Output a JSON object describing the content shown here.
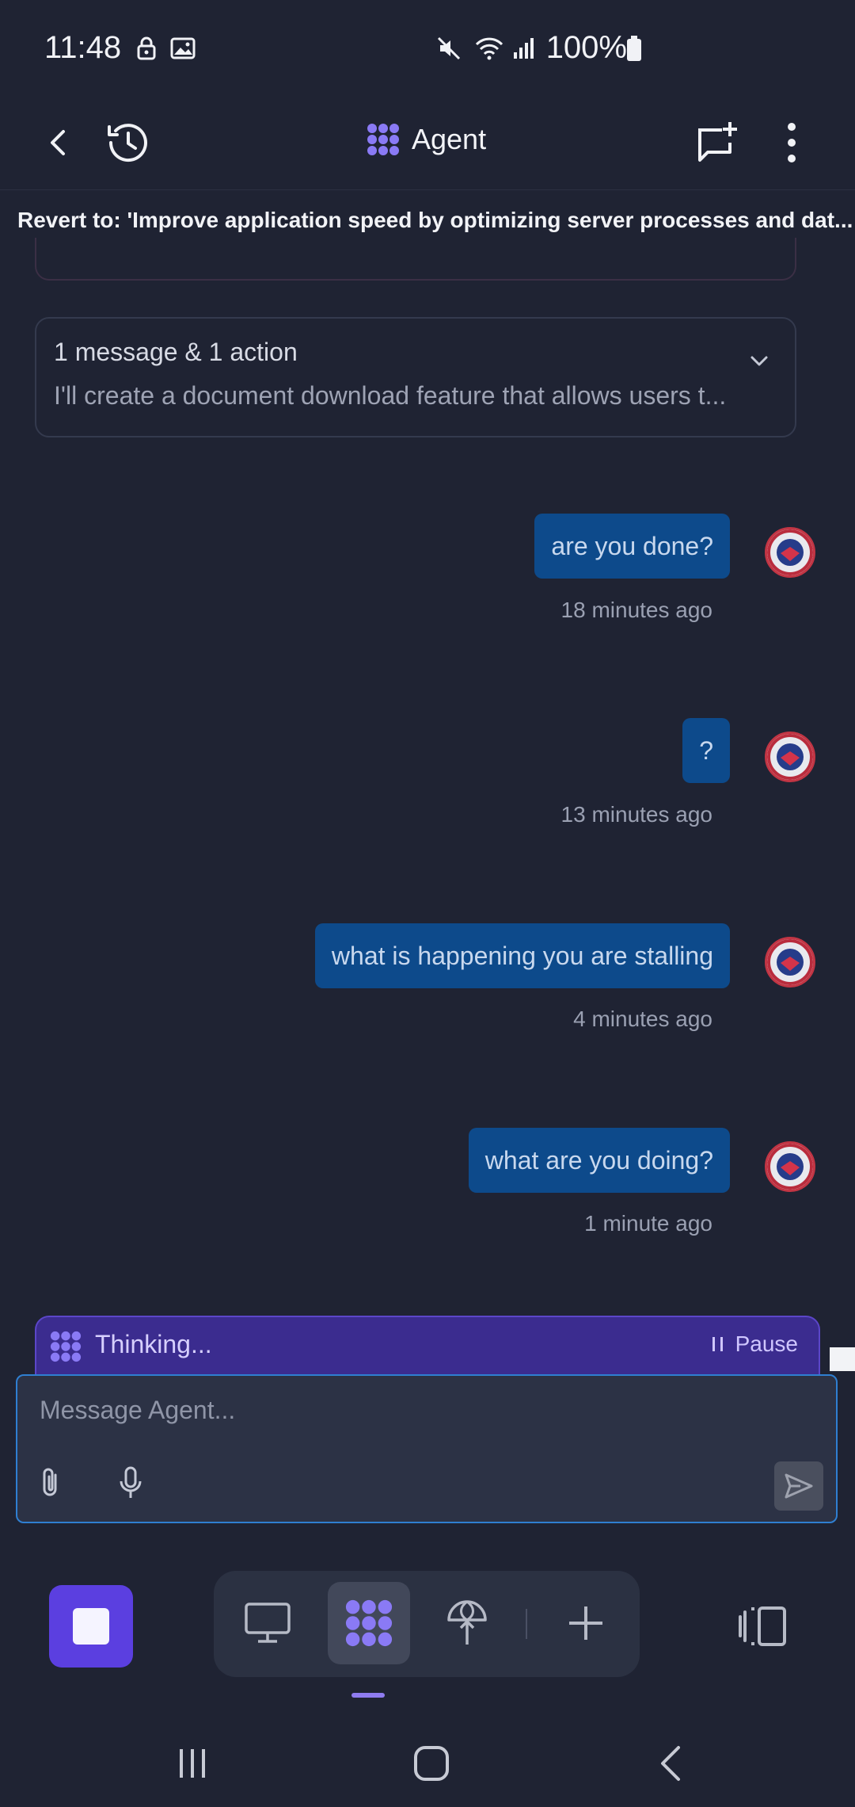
{
  "status_bar": {
    "time": "11:48",
    "battery": "100%"
  },
  "header": {
    "title": "Agent"
  },
  "revert": {
    "text": "Revert to: 'Improve application speed by optimizing server processes and dat..."
  },
  "summary_card": {
    "title": "1 message & 1 action",
    "preview": "I'll create a document download feature that allows users t..."
  },
  "messages": [
    {
      "text": "are you done?",
      "time": "18 minutes ago"
    },
    {
      "text": "?",
      "time": "13 minutes ago"
    },
    {
      "text": "what is happening you are stalling",
      "time": "4 minutes ago"
    },
    {
      "text": "what are you doing?",
      "time": "1 minute ago"
    }
  ],
  "thinking": {
    "label": "Thinking...",
    "pause_label": "Pause"
  },
  "composer": {
    "placeholder": "Message Agent..."
  },
  "colors": {
    "background": "#1f2333",
    "bubble": "#0d4a8b",
    "accent": "#5b3fe0",
    "thinking_bar": "#3b2c8f",
    "composer_border": "#2f7fd1"
  },
  "icons": [
    "back-icon",
    "history-icon",
    "agent-logo-icon",
    "new-chat-icon",
    "more-vert-icon",
    "chevron-down-icon",
    "paperclip-icon",
    "microphone-icon",
    "send-icon",
    "stop-icon",
    "desktop-icon",
    "agent-icon",
    "deploy-icon",
    "plus-icon",
    "split-view-icon"
  ]
}
